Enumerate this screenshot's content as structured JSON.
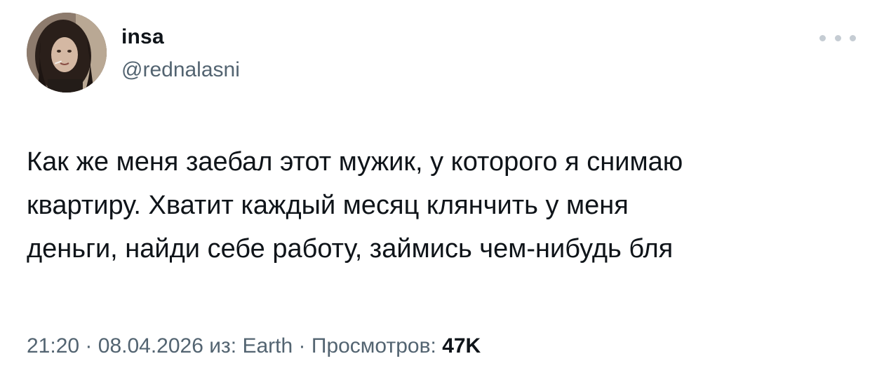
{
  "author": {
    "display_name": "insa",
    "handle": "@rednalasni",
    "avatar_icon": "avatar-photo"
  },
  "more_icon": "more-dots-icon",
  "tweet": {
    "text_lines": [
      "Как же меня заебал этот мужик, у которого я снимаю",
      "квартиру. Хватит каждый месяц клянчить у меня",
      "деньги, найди себе работу, займись чем-нибудь бля"
    ]
  },
  "meta": {
    "time": "21:20",
    "separator": "·",
    "date": "08.04.2026",
    "source_prefix": "из:",
    "source": "Earth",
    "views_label": "Просмотров:",
    "views_count": "47K"
  },
  "colors": {
    "primary_text": "#0f1419",
    "secondary_text": "#536471",
    "background": "#ffffff"
  }
}
